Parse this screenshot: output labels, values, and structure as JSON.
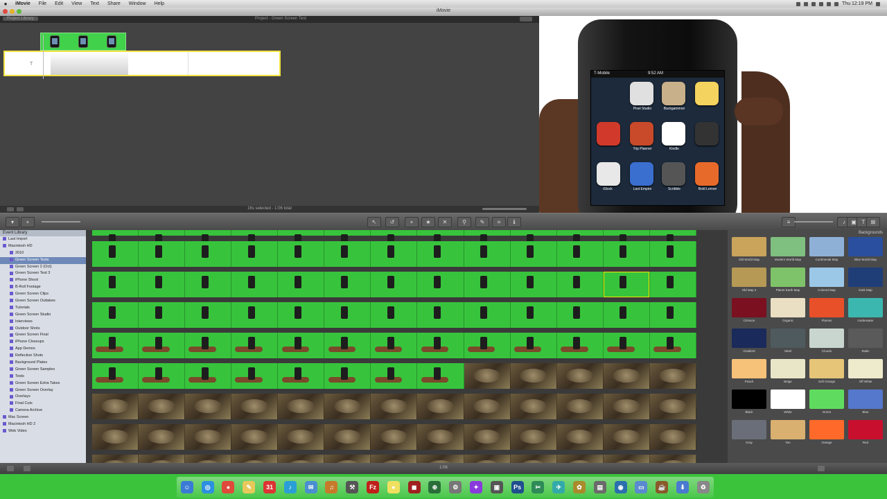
{
  "menubar": {
    "app_name": "iMovie",
    "items": [
      "File",
      "Edit",
      "View",
      "Text",
      "Share",
      "Window",
      "Help"
    ],
    "clock": "Thu 12:19 PM"
  },
  "window": {
    "title": "iMovie"
  },
  "project": {
    "library_button": "Project Library",
    "name": "Project - Green Screen Test",
    "total": "16s selected - 1:06 total"
  },
  "viewer": {
    "carrier": "T-Mobile",
    "time": "9:52 AM",
    "app_labels": [
      "Pixel Studio",
      "Backgammon",
      "Trip Planner",
      "Kindle",
      "Last Empire",
      "Scribble",
      "iStock",
      "Bold Lemon"
    ]
  },
  "event_library": {
    "header": "Event Library",
    "items": [
      {
        "label": "Last Import",
        "selected": false
      },
      {
        "label": "Macintosh HD",
        "selected": false
      },
      {
        "label": "2010",
        "selected": false
      },
      {
        "label": "Green Screen Tests",
        "selected": true
      },
      {
        "label": "Green Screen 2 (Oct)",
        "selected": false
      },
      {
        "label": "Green Screen Test 3",
        "selected": false
      },
      {
        "label": "iPhone Shoot",
        "selected": false
      },
      {
        "label": "B-Roll Footage",
        "selected": false
      },
      {
        "label": "Green Screen Clips",
        "selected": false
      },
      {
        "label": "Green Screen Outtakes",
        "selected": false
      },
      {
        "label": "Tutorials",
        "selected": false
      },
      {
        "label": "Green Screen Studio",
        "selected": false
      },
      {
        "label": "Interviews",
        "selected": false
      },
      {
        "label": "Outdoor Shots",
        "selected": false
      },
      {
        "label": "Green Screen Final",
        "selected": false
      },
      {
        "label": "iPhone Closeups",
        "selected": false
      },
      {
        "label": "App Demos",
        "selected": false
      },
      {
        "label": "Reflection Shots",
        "selected": false
      },
      {
        "label": "Background Plates",
        "selected": false
      },
      {
        "label": "Green Screen Samples",
        "selected": false
      },
      {
        "label": "Tests",
        "selected": false
      },
      {
        "label": "Green Screen Extra Takes",
        "selected": false
      },
      {
        "label": "Green Screen Overlay",
        "selected": false
      },
      {
        "label": "Overlays",
        "selected": false
      },
      {
        "label": "Final Cuts",
        "selected": false
      },
      {
        "label": "Camera Archive",
        "selected": false
      },
      {
        "label": "Mac Screen",
        "selected": false
      },
      {
        "label": "Macintosh HD 2",
        "selected": false
      },
      {
        "label": "Web Video",
        "selected": false
      }
    ]
  },
  "backgrounds": {
    "header": "Backgrounds",
    "items": [
      {
        "label": "Old World Map",
        "color": "#c9a45a"
      },
      {
        "label": "Modern World Map",
        "color": "#7fbf7f"
      },
      {
        "label": "Continental Map",
        "color": "#8fb0d6"
      },
      {
        "label": "Blue World Map",
        "color": "#2a4f9e"
      },
      {
        "label": "Old Map 2",
        "color": "#b59955"
      },
      {
        "label": "Planet Earth Map",
        "color": "#7ec26a"
      },
      {
        "label": "Colored Map",
        "color": "#9cc8e8"
      },
      {
        "label": "Dark Map",
        "color": "#1f3e78"
      },
      {
        "label": "Crimson",
        "color": "#7a1020"
      },
      {
        "label": "Organic",
        "color": "#eadfc3"
      },
      {
        "label": "Flames",
        "color": "#e8502a"
      },
      {
        "label": "Underwater",
        "color": "#3cb7b0"
      },
      {
        "label": "Gradient",
        "color": "#1a2a5a"
      },
      {
        "label": "Steel",
        "color": "#4e5a5e"
      },
      {
        "label": "Clouds",
        "color": "#c9d6d0"
      },
      {
        "label": "Static",
        "color": "#5a5a5a"
      },
      {
        "label": "Peach",
        "color": "#f6c27a"
      },
      {
        "label": "Beige",
        "color": "#e9e6c8"
      },
      {
        "label": "Soft Orange",
        "color": "#e6c578"
      },
      {
        "label": "Off White",
        "color": "#eeeacc"
      },
      {
        "label": "Black",
        "color": "#000000"
      },
      {
        "label": "White",
        "color": "#ffffff"
      },
      {
        "label": "Green",
        "color": "#5fdc5f"
      },
      {
        "label": "Blue",
        "color": "#5577cc"
      },
      {
        "label": "Gray",
        "color": "#6a6e78"
      },
      {
        "label": "Tan",
        "color": "#d9b070"
      },
      {
        "label": "Orange",
        "color": "#ff6a2a"
      },
      {
        "label": "Red",
        "color": "#c8102e"
      }
    ]
  },
  "status": {
    "clip_info": "1:06"
  },
  "dock": {
    "apps": [
      {
        "name": "finder",
        "glyph": "☺",
        "color": "#3a7bd5"
      },
      {
        "name": "safari",
        "glyph": "◎",
        "color": "#2d8fe0"
      },
      {
        "name": "chrome",
        "glyph": "●",
        "color": "#e04a3a"
      },
      {
        "name": "notes",
        "glyph": "✎",
        "color": "#e8c85a"
      },
      {
        "name": "ical",
        "glyph": "31",
        "color": "#d33"
      },
      {
        "name": "itunes",
        "glyph": "♪",
        "color": "#2a9fd6"
      },
      {
        "name": "mail",
        "glyph": "✉",
        "color": "#4a8fd0"
      },
      {
        "name": "guitar",
        "glyph": "♫",
        "color": "#c77a2a"
      },
      {
        "name": "xcode",
        "glyph": "⚒",
        "color": "#555"
      },
      {
        "name": "filezilla",
        "glyph": "Fz",
        "color": "#c0201a"
      },
      {
        "name": "ball",
        "glyph": "●",
        "color": "#f0e060"
      },
      {
        "name": "photobooth",
        "glyph": "◼",
        "color": "#a02020"
      },
      {
        "name": "dashboard",
        "glyph": "⊕",
        "color": "#2a6e3a"
      },
      {
        "name": "syspref",
        "glyph": "⚙",
        "color": "#777"
      },
      {
        "name": "chat",
        "glyph": "✦",
        "color": "#8a3adc"
      },
      {
        "name": "ical2",
        "glyph": "▣",
        "color": "#555"
      },
      {
        "name": "photoshop",
        "glyph": "Ps",
        "color": "#1f4f8f"
      },
      {
        "name": "tool1",
        "glyph": "✂",
        "color": "#2e8b57"
      },
      {
        "name": "tool2",
        "glyph": "✈",
        "color": "#3aa"
      },
      {
        "name": "tool3",
        "glyph": "✿",
        "color": "#aa8a2a"
      },
      {
        "name": "preview",
        "glyph": "▤",
        "color": "#6a6a6a"
      },
      {
        "name": "spotlight",
        "glyph": "◉",
        "color": "#2a6fae"
      },
      {
        "name": "folder",
        "glyph": "▭",
        "color": "#5a8ad0"
      },
      {
        "name": "cup",
        "glyph": "☕",
        "color": "#8a5a2a"
      },
      {
        "name": "downloads",
        "glyph": "⬇",
        "color": "#4a7ad0"
      },
      {
        "name": "trash",
        "glyph": "♻",
        "color": "#888"
      }
    ]
  }
}
